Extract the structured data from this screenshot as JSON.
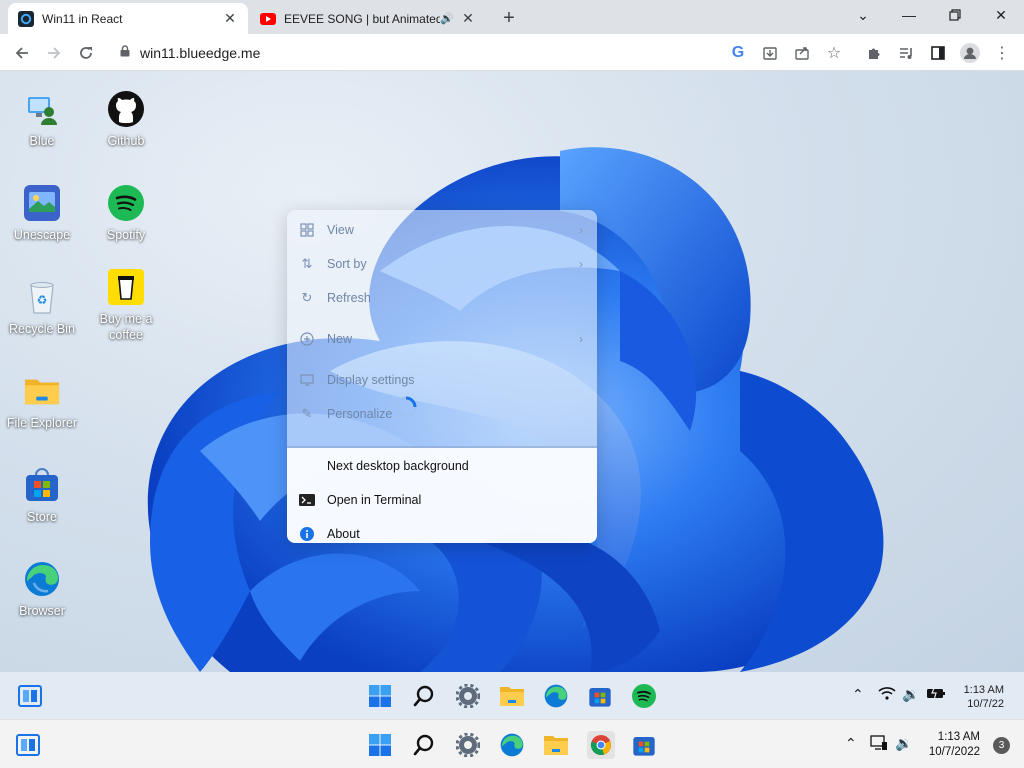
{
  "browser": {
    "tabs": [
      {
        "title": "Win11 in React",
        "active": true
      },
      {
        "title": "EEVEE SONG | but Animated",
        "active": false
      }
    ],
    "url": "win11.blueedge.me"
  },
  "desktop_icons": [
    {
      "label": "Blue",
      "icon": "user-pc-icon"
    },
    {
      "label": "Github",
      "icon": "github-icon"
    },
    {
      "label": "Unescape",
      "icon": "unescape-icon"
    },
    {
      "label": "Spotify",
      "icon": "spotify-icon"
    },
    {
      "label": "Recycle Bin",
      "icon": "recycle-bin-icon"
    },
    {
      "label": "Buy me a coffee",
      "icon": "coffee-icon"
    },
    {
      "label": "File Explorer",
      "icon": "folder-icon"
    },
    {
      "label": "Store",
      "icon": "store-icon"
    },
    {
      "label": "Browser",
      "icon": "edge-icon"
    }
  ],
  "context_menu": {
    "items": [
      {
        "label": "View",
        "icon": "view-grid-icon",
        "submenu": true
      },
      {
        "label": "Sort by",
        "icon": "sort-icon",
        "submenu": true
      },
      {
        "label": "Refresh",
        "icon": "refresh-icon",
        "submenu": false
      },
      {
        "label": "New",
        "icon": "new-plus-icon",
        "submenu": true
      },
      {
        "label": "Display settings",
        "icon": "display-icon",
        "submenu": false
      },
      {
        "label": "Personalize",
        "icon": "pen-icon",
        "submenu": false
      },
      {
        "label": "Next desktop background",
        "icon": "",
        "submenu": false
      },
      {
        "label": "Open in Terminal",
        "icon": "terminal-icon",
        "submenu": false
      },
      {
        "label": "About",
        "icon": "info-icon",
        "submenu": false
      }
    ]
  },
  "win11_taskbar": {
    "time": "1:13 AM",
    "date": "10/7/22"
  },
  "host_taskbar": {
    "time": "1:13 AM",
    "date": "10/7/2022",
    "notification_count": "3"
  },
  "colors": {
    "accent": "#1a73e8",
    "bloom": "#1565e0",
    "spotify": "#1db954",
    "youtube": "#ff0000"
  }
}
